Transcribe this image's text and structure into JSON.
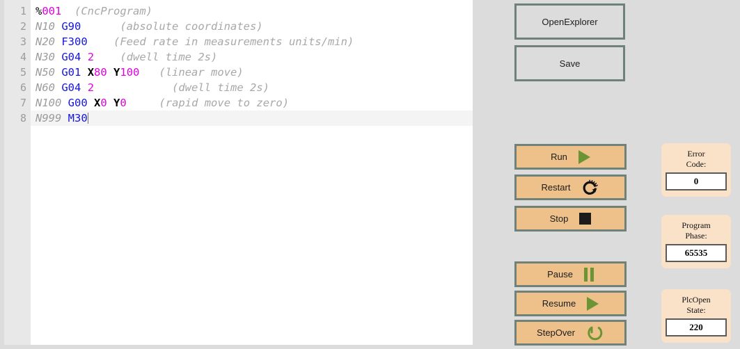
{
  "editor": {
    "name": "cnc-program-editor",
    "line_numbers": [
      "1",
      "2",
      "3",
      "4",
      "5",
      "6",
      "7",
      "8"
    ],
    "current_line": 8,
    "lines": [
      [
        {
          "t": "%",
          "c": "sym"
        },
        {
          "t": "001",
          "c": "num"
        },
        {
          "t": "  ",
          "c": "plain"
        },
        {
          "t": "(CncProgram)",
          "c": "cmt"
        }
      ],
      [
        {
          "t": "N10",
          "c": "nblk"
        },
        {
          "t": " ",
          "c": "plain"
        },
        {
          "t": "G90",
          "c": "gcode"
        },
        {
          "t": "      ",
          "c": "plain"
        },
        {
          "t": "(absolute coordinates)",
          "c": "cmt"
        }
      ],
      [
        {
          "t": "N20",
          "c": "nblk"
        },
        {
          "t": " ",
          "c": "plain"
        },
        {
          "t": "F300",
          "c": "gcode"
        },
        {
          "t": "    ",
          "c": "plain"
        },
        {
          "t": "(Feed rate in measurements units/min)",
          "c": "cmt"
        }
      ],
      [
        {
          "t": "N30",
          "c": "nblk"
        },
        {
          "t": " ",
          "c": "plain"
        },
        {
          "t": "G04",
          "c": "gcode"
        },
        {
          "t": " ",
          "c": "plain"
        },
        {
          "t": "2",
          "c": "num"
        },
        {
          "t": "    ",
          "c": "plain"
        },
        {
          "t": "(dwell time 2s)",
          "c": "cmt"
        }
      ],
      [
        {
          "t": "N50",
          "c": "nblk"
        },
        {
          "t": " ",
          "c": "plain"
        },
        {
          "t": "G01",
          "c": "gcode"
        },
        {
          "t": " ",
          "c": "plain"
        },
        {
          "t": "X",
          "c": "axis"
        },
        {
          "t": "80",
          "c": "num"
        },
        {
          "t": " ",
          "c": "plain"
        },
        {
          "t": "Y",
          "c": "axis"
        },
        {
          "t": "100",
          "c": "num"
        },
        {
          "t": "   ",
          "c": "plain"
        },
        {
          "t": "(linear move)",
          "c": "cmt"
        }
      ],
      [
        {
          "t": "N60",
          "c": "nblk"
        },
        {
          "t": " ",
          "c": "plain"
        },
        {
          "t": "G04",
          "c": "gcode"
        },
        {
          "t": " ",
          "c": "plain"
        },
        {
          "t": "2",
          "c": "num"
        },
        {
          "t": "            ",
          "c": "plain"
        },
        {
          "t": "(dwell time 2s)",
          "c": "cmt"
        }
      ],
      [
        {
          "t": "N100",
          "c": "nblk"
        },
        {
          "t": " ",
          "c": "plain"
        },
        {
          "t": "G00",
          "c": "gcode"
        },
        {
          "t": " ",
          "c": "plain"
        },
        {
          "t": "X",
          "c": "axis"
        },
        {
          "t": "0",
          "c": "num"
        },
        {
          "t": " ",
          "c": "plain"
        },
        {
          "t": "Y",
          "c": "axis"
        },
        {
          "t": "0",
          "c": "num"
        },
        {
          "t": "     ",
          "c": "plain"
        },
        {
          "t": "(rapid move to zero)",
          "c": "cmt"
        }
      ],
      [
        {
          "t": "N999",
          "c": "nblk"
        },
        {
          "t": " ",
          "c": "plain"
        },
        {
          "t": "M30",
          "c": "gcode"
        }
      ]
    ]
  },
  "file_buttons": [
    {
      "id": "btn-openexplorer",
      "name": "open-explorer-button",
      "label": "OpenExplorer"
    },
    {
      "id": "btn-save",
      "name": "save-button",
      "label": "Save"
    }
  ],
  "control_buttons": [
    {
      "id": "btn-run",
      "name": "run-button",
      "label": "Run",
      "icon": "play-icon"
    },
    {
      "id": "btn-restart",
      "name": "restart-button",
      "label": "Restart",
      "icon": "restart-icon"
    },
    {
      "id": "btn-stop",
      "name": "stop-button",
      "label": "Stop",
      "icon": "stop-icon"
    },
    {
      "id": "btn-pause",
      "name": "pause-button",
      "label": "Pause",
      "icon": "pause-icon"
    },
    {
      "id": "btn-resume",
      "name": "resume-button",
      "label": "Resume",
      "icon": "play-icon"
    },
    {
      "id": "btn-stepover",
      "name": "step-over-button",
      "label": "StepOver",
      "icon": "step-over-icon"
    }
  ],
  "status_cards": [
    {
      "id": "card-error",
      "name": "error-code-card",
      "label_line1": "Error",
      "label_line2": "Code:",
      "value": "0"
    },
    {
      "id": "card-phase",
      "name": "program-phase-card",
      "label_line1": "Program",
      "label_line2": "Phase:",
      "value": "65535"
    },
    {
      "id": "card-plcopen",
      "name": "plcopen-state-card",
      "label_line1": "PlcOpen",
      "label_line2": "State:",
      "value": "220"
    }
  ],
  "colors": {
    "page_background": "#dcdcdc",
    "editor_background": "#ffffff",
    "gutter_background": "#e8e8e8",
    "button_border": "#6f8279",
    "action_button_fill": "#eec18b",
    "plain_button_fill": "#dcdcdc",
    "card_fill": "#fae2c8",
    "icon_green": "#6b9434",
    "icon_black": "#1c1c1c",
    "syntax_gcode": "#1414e0",
    "syntax_number": "#e000e0",
    "syntax_comment": "#a8a8a8",
    "syntax_block": "#9d9d9d"
  }
}
